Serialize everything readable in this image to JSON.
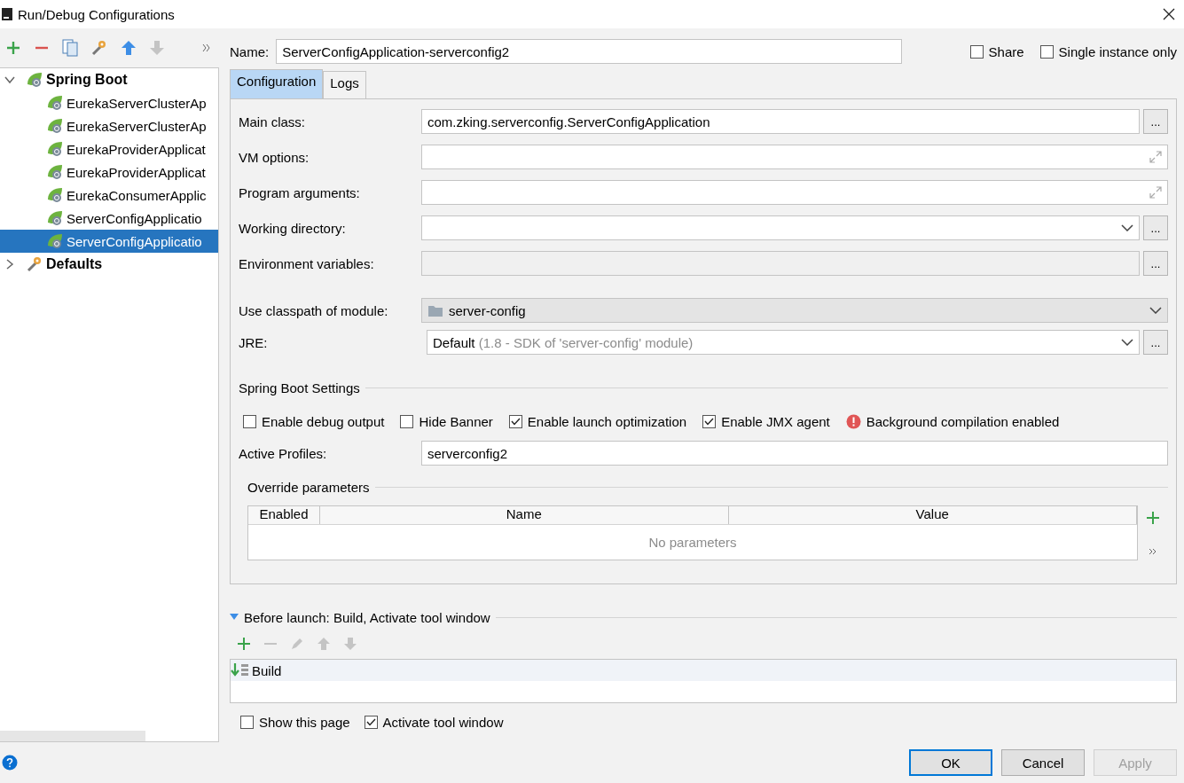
{
  "window": {
    "title": "Run/Debug Configurations"
  },
  "tree": [
    {
      "label": "Spring Boot",
      "kind": "spring",
      "expanded": true,
      "children": [
        {
          "label": "EurekaServerClusterAp",
          "selected": false
        },
        {
          "label": "EurekaServerClusterAp",
          "selected": false
        },
        {
          "label": "EurekaProviderApplicat",
          "selected": false
        },
        {
          "label": "EurekaProviderApplicat",
          "selected": false
        },
        {
          "label": "EurekaConsumerApplic",
          "selected": false
        },
        {
          "label": "ServerConfigApplicatio",
          "selected": false
        },
        {
          "label": "ServerConfigApplicatio",
          "selected": true
        }
      ]
    },
    {
      "label": "Defaults",
      "kind": "defaults",
      "expanded": false
    }
  ],
  "name": {
    "label": "Name:",
    "value": "ServerConfigApplication-serverconfig2"
  },
  "share": {
    "label": "Share",
    "checked": false
  },
  "single_instance": {
    "label": "Single instance only",
    "checked": false
  },
  "tabs": [
    {
      "label": "Configuration",
      "selected": true
    },
    {
      "label": "Logs",
      "selected": false
    }
  ],
  "fields": [
    {
      "kind": "text",
      "label": "Main class:",
      "value": "com.zking.serverconfig.ServerConfigApplication",
      "button": "..."
    },
    {
      "kind": "expand",
      "label": "VM options:"
    },
    {
      "kind": "expand",
      "label": "Program arguments:"
    },
    {
      "kind": "combo",
      "label": "Working directory:",
      "button": "..."
    },
    {
      "kind": "readonly",
      "label": "Environment variables:",
      "button": "..."
    },
    {
      "kind": "module",
      "label": "Use classpath of module:",
      "value": "server-config"
    },
    {
      "kind": "jre",
      "label": "JRE:",
      "value": "Default",
      "hint": "(1.8 - SDK of 'server-config' module)",
      "button": "..."
    }
  ],
  "spring_boot_settings": {
    "title": "Spring Boot Settings",
    "options": [
      {
        "label": "Enable debug output",
        "checked": false
      },
      {
        "label": "Hide Banner",
        "checked": false
      },
      {
        "label": "Enable launch optimization",
        "checked": true
      },
      {
        "label": "Enable JMX agent",
        "checked": true
      }
    ],
    "status": "Background compilation enabled",
    "active_profiles": {
      "label": "Active Profiles:",
      "value": "serverconfig2"
    }
  },
  "override_parameters": {
    "title": "Override parameters",
    "columns": [
      "Enabled",
      "Name",
      "Value"
    ],
    "empty_text": "No parameters"
  },
  "before_launch": {
    "title": "Before launch: Build, Activate tool window",
    "expanded": true,
    "tasks": [
      {
        "label": "Build"
      }
    ],
    "options": [
      {
        "label": "Show this page",
        "checked": false
      },
      {
        "label": "Activate tool window",
        "checked": true
      }
    ]
  },
  "buttons": [
    {
      "label": "OK",
      "default": true,
      "disabled": false
    },
    {
      "label": "Cancel",
      "default": false,
      "disabled": false
    },
    {
      "label": "Apply",
      "default": false,
      "disabled": true
    }
  ]
}
